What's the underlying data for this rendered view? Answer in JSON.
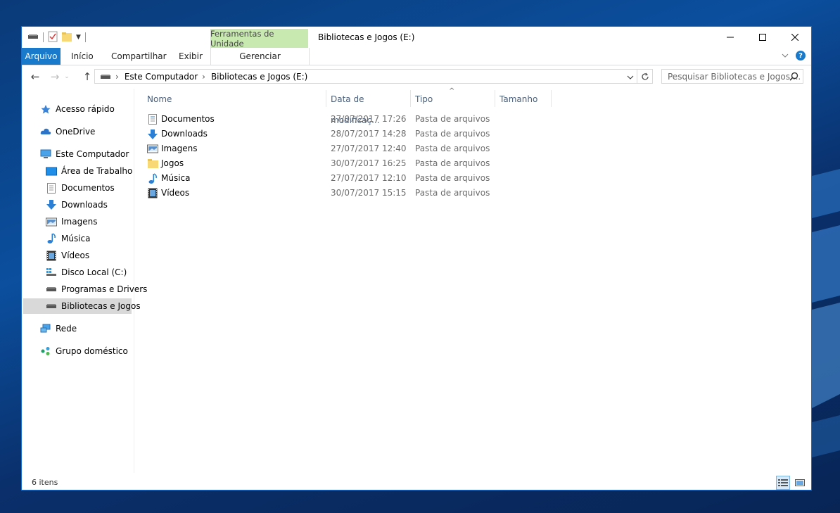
{
  "window": {
    "title": "Bibliotecas e Jogos (E:)",
    "context_tab_group": "Ferramentas de Unidade",
    "caption": {
      "minimize": "—",
      "maximize": "☐",
      "close": "✕"
    }
  },
  "ribbon": {
    "tabs": [
      "Arquivo",
      "Início",
      "Compartilhar",
      "Exibir"
    ],
    "context_tab": "Gerenciar",
    "expand_symbol": "⌄",
    "help_symbol": "?"
  },
  "navigation": {
    "back": "←",
    "forward": "→",
    "up": "↑",
    "breadcrumb": [
      "Este Computador",
      "Bibliotecas e Jogos (E:)"
    ],
    "search_placeholder": "Pesquisar Bibliotecas e Jogos ..."
  },
  "sidebar": {
    "items": [
      {
        "label": "Acesso rápido",
        "icon": "star-icon"
      },
      {
        "label": "OneDrive",
        "icon": "cloud-icon"
      },
      {
        "label": "Este Computador",
        "icon": "computer-icon"
      },
      {
        "label": "Área de Trabalho",
        "icon": "desktop-icon"
      },
      {
        "label": "Documentos",
        "icon": "document-icon"
      },
      {
        "label": "Downloads",
        "icon": "download-icon"
      },
      {
        "label": "Imagens",
        "icon": "image-icon"
      },
      {
        "label": "Música",
        "icon": "music-icon"
      },
      {
        "label": "Vídeos",
        "icon": "video-icon"
      },
      {
        "label": "Disco Local (C:)",
        "icon": "windows-drive-icon"
      },
      {
        "label": "Programas e Drivers",
        "icon": "drive-icon"
      },
      {
        "label": "Bibliotecas e Jogos",
        "icon": "drive-icon",
        "selected": true
      },
      {
        "label": "Rede",
        "icon": "network-icon"
      },
      {
        "label": "Grupo doméstico",
        "icon": "homegroup-icon"
      }
    ]
  },
  "columns": [
    "Nome",
    "Data de modificaç...",
    "Tipo",
    "Tamanho"
  ],
  "files": [
    {
      "name": "Documentos",
      "date": "27/07/2017 17:26",
      "type": "Pasta de arquivos",
      "icon": "document-icon"
    },
    {
      "name": "Downloads",
      "date": "28/07/2017 14:28",
      "type": "Pasta de arquivos",
      "icon": "download-icon"
    },
    {
      "name": "Imagens",
      "date": "27/07/2017 12:40",
      "type": "Pasta de arquivos",
      "icon": "image-icon"
    },
    {
      "name": "Jogos",
      "date": "30/07/2017 16:25",
      "type": "Pasta de arquivos",
      "icon": "folder-icon"
    },
    {
      "name": "Música",
      "date": "27/07/2017 12:10",
      "type": "Pasta de arquivos",
      "icon": "music-icon"
    },
    {
      "name": "Vídeos",
      "date": "30/07/2017 15:15",
      "type": "Pasta de arquivos",
      "icon": "video-icon"
    }
  ],
  "status": {
    "item_count": "6 itens"
  },
  "colors": {
    "accent": "#1979ca",
    "context_tab": "#c8eab0",
    "selection": "#d9d9d9"
  }
}
